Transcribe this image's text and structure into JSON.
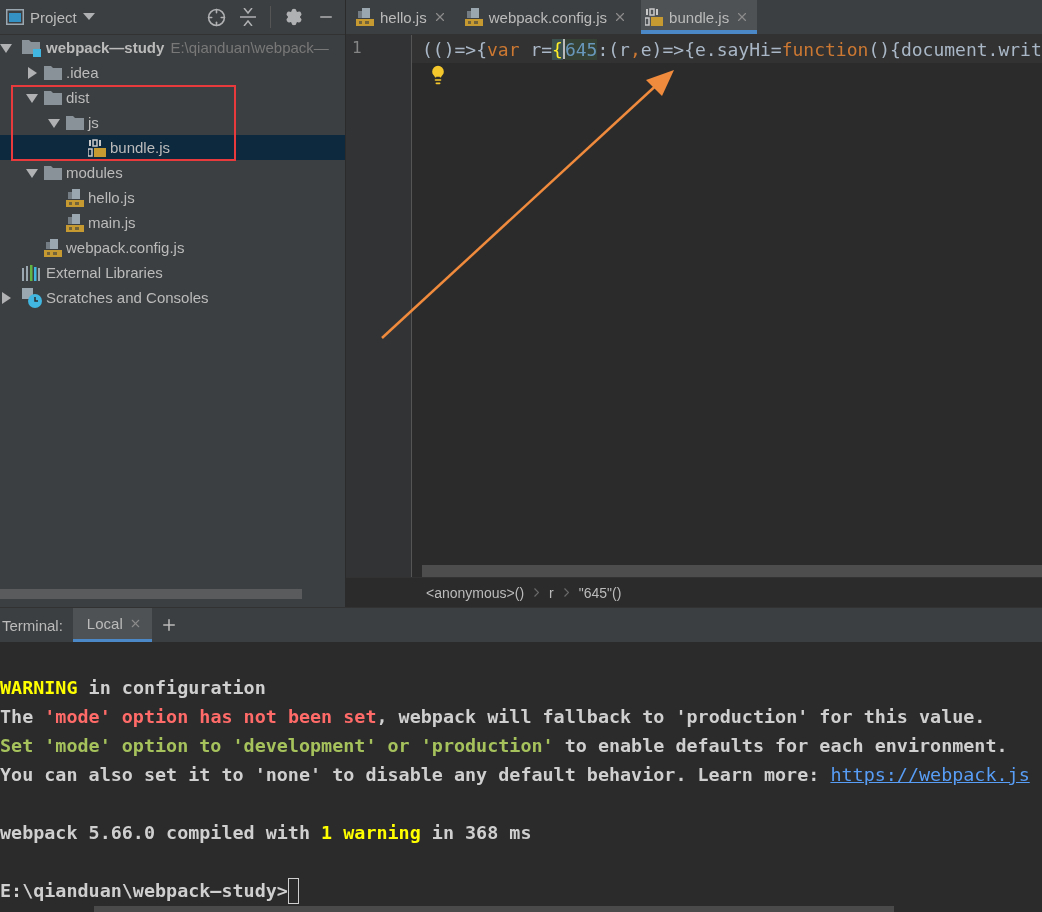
{
  "project_panel": {
    "title": "Project",
    "tree": [
      {
        "label": "webpack—study",
        "path": "E:\\qianduan\\webpack—",
        "kind": "project",
        "expanded": true,
        "selected": false,
        "children": [
          {
            "label": ".idea",
            "kind": "folder",
            "expanded": false,
            "selected": false
          },
          {
            "label": "dist",
            "kind": "folder",
            "expanded": true,
            "selected": false,
            "children": [
              {
                "label": "js",
                "kind": "folder",
                "expanded": true,
                "selected": false,
                "children": [
                  {
                    "label": "bundle.js",
                    "kind": "bundle",
                    "selected": true
                  }
                ]
              }
            ]
          },
          {
            "label": "modules",
            "kind": "folder",
            "expanded": true,
            "selected": false,
            "children": [
              {
                "label": "hello.js",
                "kind": "js",
                "selected": false
              },
              {
                "label": "main.js",
                "kind": "js",
                "selected": false
              }
            ]
          },
          {
            "label": "webpack.config.js",
            "kind": "js",
            "selected": false
          }
        ]
      },
      {
        "label": "External Libraries",
        "kind": "libraries",
        "selected": false
      },
      {
        "label": "Scratches and Consoles",
        "kind": "scratches",
        "expanded": false,
        "selected": false
      }
    ]
  },
  "editor": {
    "tabs": [
      {
        "label": "hello.js",
        "kind": "js",
        "selected": false
      },
      {
        "label": "webpack.config.js",
        "kind": "js",
        "selected": false
      },
      {
        "label": "bundle.js",
        "kind": "bundle",
        "selected": true
      }
    ],
    "line_number": "1",
    "code_line": [
      {
        "kind": "plain",
        "text": "(()=>{"
      },
      {
        "kind": "keyword",
        "text": "var"
      },
      {
        "kind": "plain",
        "text": " r="
      },
      {
        "kind": "brace",
        "text": "{"
      },
      {
        "kind": "cursor"
      },
      {
        "kind": "number",
        "text": "645"
      },
      {
        "kind": "plain",
        "text": ":(r"
      },
      {
        "kind": "keyword",
        "text": ","
      },
      {
        "kind": "plain",
        "text": "e)=>{e.sayHi="
      },
      {
        "kind": "keyword",
        "text": "function"
      },
      {
        "kind": "plain",
        "text": "(){document.writ"
      }
    ],
    "breadcrumbs": [
      "<anonymous>()",
      "r",
      "\"645\"()"
    ]
  },
  "terminal": {
    "title": "Terminal:",
    "tabs": [
      {
        "label": "Local",
        "selected": true
      }
    ],
    "lines": [
      {
        "kind": "blank"
      },
      {
        "kind": "text",
        "segments": [
          {
            "kind": "warning",
            "text": "WARNING"
          },
          {
            "kind": "plain",
            "text": " in configuration"
          }
        ]
      },
      {
        "kind": "text",
        "segments": [
          {
            "kind": "plain",
            "text": "The "
          },
          {
            "kind": "error",
            "text": "'mode' option has not been set"
          },
          {
            "kind": "plain",
            "text": ", webpack will fallback to 'production' for this value."
          }
        ]
      },
      {
        "kind": "text",
        "segments": [
          {
            "kind": "hint",
            "text": "Set 'mode' option to 'development' or 'production'"
          },
          {
            "kind": "plain",
            "text": " to enable defaults for each environment."
          }
        ]
      },
      {
        "kind": "text",
        "segments": [
          {
            "kind": "plain",
            "text": "You can also set it to 'none' to disable any default behavior. Learn more: "
          },
          {
            "kind": "link",
            "text": "https://webpack.js"
          }
        ]
      },
      {
        "kind": "blank"
      },
      {
        "kind": "text",
        "segments": [
          {
            "kind": "plain",
            "text": "webpack 5.66.0 compiled with "
          },
          {
            "kind": "warning",
            "text": "1 warning"
          },
          {
            "kind": "plain",
            "text": " in 368 ms"
          }
        ]
      },
      {
        "kind": "blank"
      },
      {
        "kind": "prompt",
        "segments": [
          {
            "kind": "plain",
            "text": "E:\\qianduan\\webpack—study>"
          }
        ]
      }
    ]
  }
}
